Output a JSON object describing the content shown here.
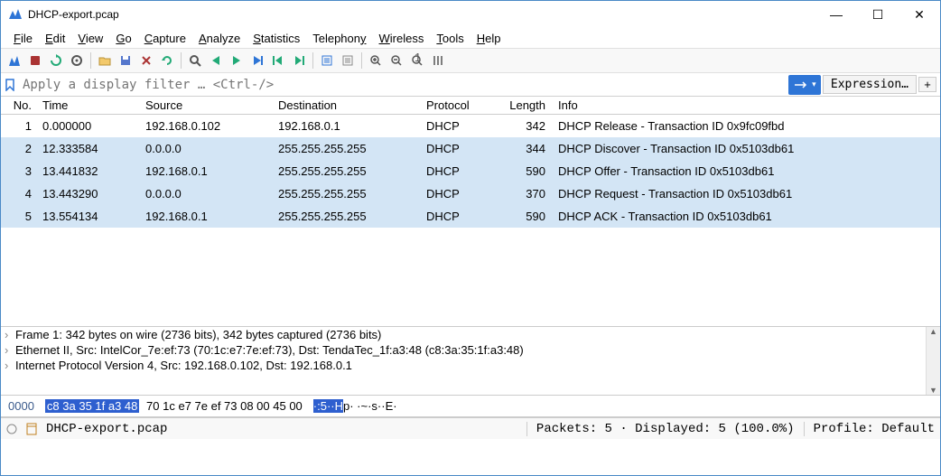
{
  "window": {
    "title": "DHCP-export.pcap",
    "min": "—",
    "max": "☐",
    "close": "✕"
  },
  "menus": [
    {
      "label": "File",
      "u": 0
    },
    {
      "label": "Edit",
      "u": 0
    },
    {
      "label": "View",
      "u": 0
    },
    {
      "label": "Go",
      "u": 0
    },
    {
      "label": "Capture",
      "u": 0
    },
    {
      "label": "Analyze",
      "u": 0
    },
    {
      "label": "Statistics",
      "u": 0
    },
    {
      "label": "Telephony",
      "u": 8
    },
    {
      "label": "Wireless",
      "u": 0
    },
    {
      "label": "Tools",
      "u": 0
    },
    {
      "label": "Help",
      "u": 0
    }
  ],
  "toolbar_icons": [
    "shark",
    "stop",
    "restart",
    "options",
    "sep",
    "open",
    "save",
    "close",
    "reload",
    "sep",
    "find",
    "prev",
    "next",
    "goto",
    "first",
    "last",
    "sep",
    "auto-scroll",
    "colorize",
    "sep",
    "zoom-in",
    "zoom-out",
    "zoom-reset",
    "resize-cols"
  ],
  "filter": {
    "placeholder": "Apply a display filter … <Ctrl-/>",
    "expression_label": "Expression…",
    "plus": "+"
  },
  "columns": [
    "No.",
    "Time",
    "Source",
    "Destination",
    "Protocol",
    "Length",
    "Info"
  ],
  "packets": [
    {
      "no": "1",
      "time": "0.000000",
      "src": "192.168.0.102",
      "dst": "192.168.0.1",
      "proto": "DHCP",
      "len": "342",
      "info": "DHCP Release  - Transaction ID 0x9fc09fbd",
      "bg": "#ffffff"
    },
    {
      "no": "2",
      "time": "12.333584",
      "src": "0.0.0.0",
      "dst": "255.255.255.255",
      "proto": "DHCP",
      "len": "344",
      "info": "DHCP Discover - Transaction ID 0x5103db61",
      "bg": "#d3e5f5"
    },
    {
      "no": "3",
      "time": "13.441832",
      "src": "192.168.0.1",
      "dst": "255.255.255.255",
      "proto": "DHCP",
      "len": "590",
      "info": "DHCP Offer    - Transaction ID 0x5103db61",
      "bg": "#d3e5f5"
    },
    {
      "no": "4",
      "time": "13.443290",
      "src": "0.0.0.0",
      "dst": "255.255.255.255",
      "proto": "DHCP",
      "len": "370",
      "info": "DHCP Request  - Transaction ID 0x5103db61",
      "bg": "#d3e5f5"
    },
    {
      "no": "5",
      "time": "13.554134",
      "src": "192.168.0.1",
      "dst": "255.255.255.255",
      "proto": "DHCP",
      "len": "590",
      "info": "DHCP ACK      - Transaction ID 0x5103db61",
      "bg": "#d3e5f5"
    }
  ],
  "details": [
    "Frame 1: 342 bytes on wire (2736 bits), 342 bytes captured (2736 bits)",
    "Ethernet II, Src: IntelCor_7e:ef:73 (70:1c:e7:7e:ef:73), Dst: TendaTec_1f:a3:48 (c8:3a:35:1f:a3:48)",
    "Internet Protocol Version 4, Src: 192.168.0.102, Dst: 192.168.0.1"
  ],
  "hex": {
    "offset": "0000",
    "selected": "c8 3a 35 1f a3 48",
    "rest1": "70 1c  e7 7e ef 73 08 00 45 00",
    "ascii_sel": "·:5··H",
    "ascii_rest": "p·  ·~·s··E·"
  },
  "status": {
    "file": "DHCP-export.pcap",
    "packets": "Packets: 5 · Displayed: 5 (100.0%)",
    "profile": "Profile: Default"
  }
}
